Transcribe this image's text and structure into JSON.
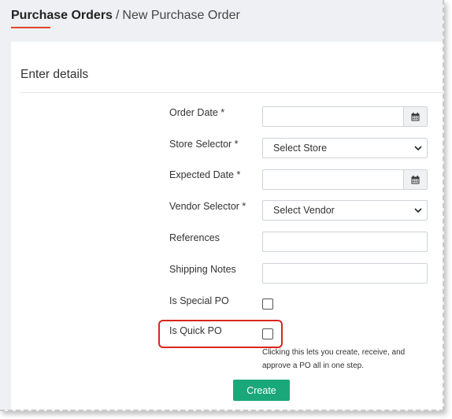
{
  "breadcrumb": {
    "root": "Purchase Orders",
    "separator": "/",
    "current": "New Purchase Order"
  },
  "section": {
    "title": "Enter details"
  },
  "form": {
    "order_date": {
      "label": "Order Date *",
      "value": "",
      "icon": "calendar-icon"
    },
    "store_selector": {
      "label": "Store Selector *",
      "selected": "Select Store",
      "icon": "chevron-down-icon"
    },
    "expected_date": {
      "label": "Expected Date *",
      "value": "",
      "icon": "calendar-icon"
    },
    "vendor_selector": {
      "label": "Vendor Selector *",
      "selected": "Select Vendor",
      "icon": "chevron-down-icon"
    },
    "references": {
      "label": "References",
      "value": ""
    },
    "shipping_notes": {
      "label": "Shipping Notes",
      "value": ""
    },
    "is_special_po": {
      "label": "Is Special PO",
      "checked": false
    },
    "is_quick_po": {
      "label": "Is Quick PO",
      "checked": false,
      "help": "Clicking this lets you create, receive, and approve a PO all in one step."
    },
    "create_label": "Create"
  },
  "colors": {
    "accent_underline": "#e0452b",
    "highlight_border": "#d9261c",
    "create_button": "#1aa77a",
    "page_background": "#eef0f3"
  }
}
